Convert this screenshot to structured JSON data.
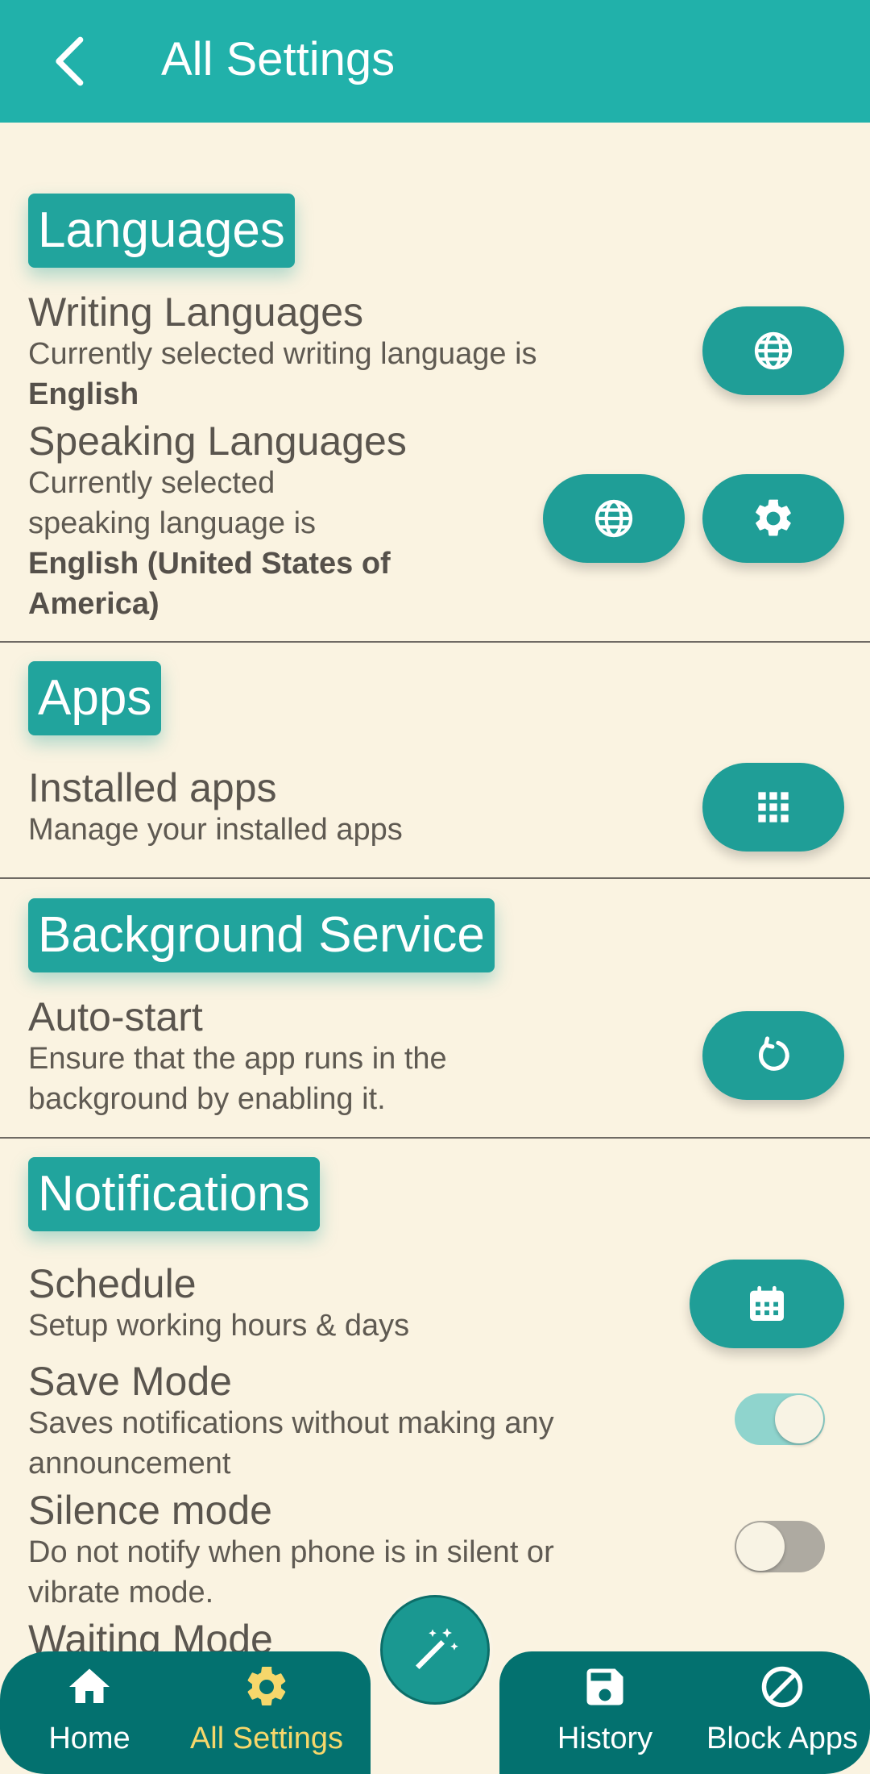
{
  "appbar": {
    "title": "All Settings"
  },
  "languages": {
    "section_title": "Languages",
    "writing": {
      "title": "Writing Languages",
      "subtitle": "Currently selected writing language is",
      "value": "English"
    },
    "speaking": {
      "title": "Speaking Languages",
      "subtitle_line1": "Currently selected",
      "subtitle_line2": "speaking language is",
      "value_line1": "English (United States of",
      "value_line2": "America)"
    }
  },
  "apps": {
    "section_title": "Apps",
    "installed": {
      "title": "Installed apps",
      "subtitle": "Manage your installed apps"
    }
  },
  "background_service": {
    "section_title": "Background Service",
    "autostart": {
      "title": "Auto-start",
      "subtitle_line1": "Ensure that the app runs in the",
      "subtitle_line2": "background by enabling it."
    }
  },
  "notifications": {
    "section_title": "Notifications",
    "schedule": {
      "title": "Schedule",
      "subtitle": "Setup working hours & days"
    },
    "save_mode": {
      "title": "Save Mode",
      "subtitle_line1": "Saves notifications without making any",
      "subtitle_line2": "announcement",
      "enabled": true
    },
    "silence_mode": {
      "title": "Silence mode",
      "subtitle_line1": "Do not notify when phone is in silent or",
      "subtitle_line2": "vibrate mode.",
      "enabled": false
    },
    "waiting_mode": {
      "title": "Waiting Mode"
    }
  },
  "bottom_nav": {
    "items": [
      {
        "label": "Home",
        "icon": "home-icon",
        "active": false
      },
      {
        "label": "All Settings",
        "icon": "gear-icon",
        "active": true
      },
      {
        "label": "History",
        "icon": "save-icon",
        "active": false
      },
      {
        "label": "Block Apps",
        "icon": "block-icon",
        "active": false
      }
    ],
    "fab_icon": "magic-wand-icon"
  },
  "colors": {
    "appbar": "#21b1aa",
    "accent": "#1f9e97",
    "background": "#faf3e1",
    "nav_bar": "#03716f",
    "nav_active": "#f6d76b",
    "toggle_on_track": "#8fd4cd",
    "toggle_off_track": "#aeaaa1"
  }
}
